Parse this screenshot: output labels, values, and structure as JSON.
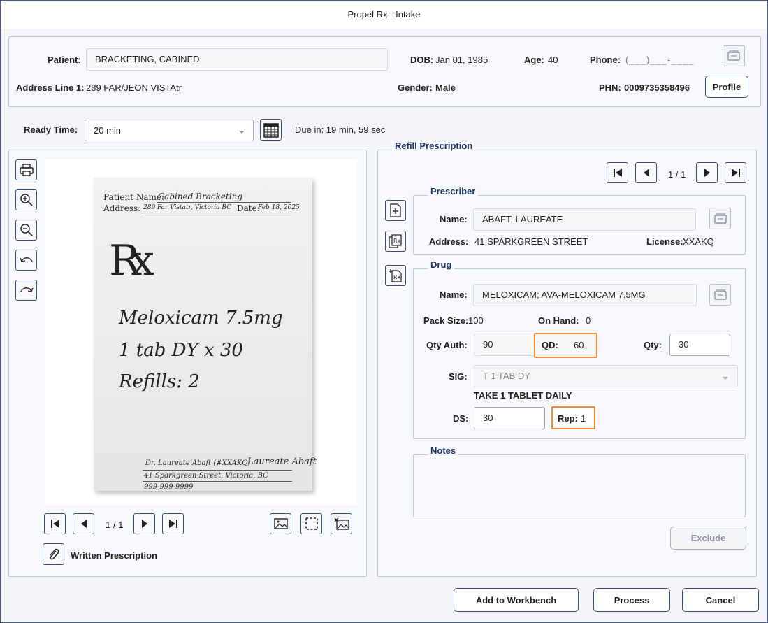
{
  "window": {
    "title": "Propel Rx - Intake"
  },
  "patient": {
    "name_label": "Patient:",
    "name": "BRACKETING, CABINED",
    "dob_label": "DOB:",
    "dob": "Jan 01, 1985",
    "age_label": "Age:",
    "age": "40",
    "phone_label": "Phone:",
    "phone_placeholder": "(___)___-____",
    "address_label": "Address Line 1:",
    "address": "289 FAR/JEON VISTAtr",
    "gender_label": "Gender:",
    "gender": "Male",
    "phn_label": "PHN:",
    "phn": "0009735358496",
    "profile_button": "Profile"
  },
  "ready": {
    "label": "Ready Time:",
    "value": "20 min",
    "due": "Due in: 19 min, 59 sec"
  },
  "image_viewer": {
    "page": "1 / 1",
    "attachment_label": "Written Prescription",
    "rx_image": {
      "patient_name_label": "Patient Name:",
      "patient_name": "Cabined Bracketing",
      "address_label": "Address:",
      "address": "289 Far Vistatr, Victoria BC",
      "date_label": "Date:",
      "date": "Feb 18, 2025",
      "rx_symbol": "Rx",
      "line1": "Meloxicam 7.5mg",
      "line2": "1 tab DY x 30",
      "line3": "Refills: 2",
      "doctor": "Dr. Laureate Abaft (#XXAKQ)",
      "signature": "Laureate Abaft",
      "doctor_address": "41 Sparkgreen Street, Victoria, BC",
      "doctor_phone": "999-999-9999"
    }
  },
  "refill": {
    "title": "Refill Prescription",
    "page": "1 / 1",
    "prescriber": {
      "legend": "Prescriber",
      "name_label": "Name:",
      "name": "ABAFT, LAUREATE",
      "address_label": "Address:",
      "address": "41 SPARKGREEN STREET",
      "license_label": "License:",
      "license": "XXAKQ"
    },
    "drug": {
      "legend": "Drug",
      "name_label": "Name:",
      "name": "MELOXICAM; AVA-MELOXICAM 7.5MG",
      "pack_size_label": "Pack Size:",
      "pack_size": "100",
      "on_hand_label": "On Hand:",
      "on_hand": "0",
      "qty_auth_label": "Qty Auth:",
      "qty_auth": "90",
      "qd_label": "QD:",
      "qd": "60",
      "qty_label": "Qty:",
      "qty": "30",
      "sig_label": "SIG:",
      "sig": "T 1 TAB DY",
      "sig_text": "TAKE 1 TABLET DAILY",
      "ds_label": "DS:",
      "ds": "30",
      "rep_label": "Rep:",
      "rep": "1"
    },
    "notes_legend": "Notes",
    "exclude_button": "Exclude"
  },
  "footer": {
    "add_button": "Add to Workbench",
    "process_button": "Process",
    "cancel_button": "Cancel"
  },
  "colors": {
    "accent": "#1d3566",
    "highlight": "#f08a35"
  }
}
